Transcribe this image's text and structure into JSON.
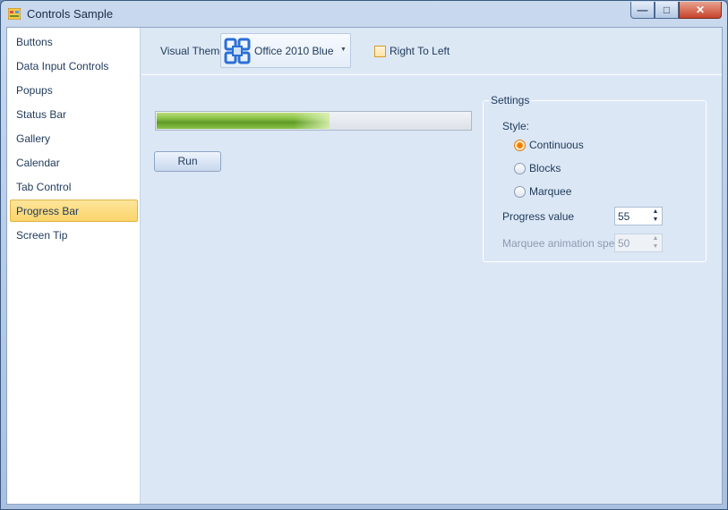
{
  "window": {
    "title": "Controls Sample"
  },
  "nav": {
    "items": [
      {
        "label": "Buttons",
        "selected": false
      },
      {
        "label": "Data Input Controls",
        "selected": false
      },
      {
        "label": "Popups",
        "selected": false
      },
      {
        "label": "Status Bar",
        "selected": false
      },
      {
        "label": "Gallery",
        "selected": false
      },
      {
        "label": "Calendar",
        "selected": false
      },
      {
        "label": "Tab Control",
        "selected": false
      },
      {
        "label": "Progress Bar",
        "selected": true
      },
      {
        "label": "Screen Tip",
        "selected": false
      }
    ]
  },
  "toolbar": {
    "theme_label": "Visual Theme",
    "theme_value": "Office 2010 Blue",
    "rtl_label": "Right To Left",
    "rtl_checked": false
  },
  "progress": {
    "value": 55,
    "max": 100
  },
  "run_label": "Run",
  "settings": {
    "legend": "Settings",
    "style_label": "Style:",
    "styles": [
      {
        "label": "Continuous",
        "checked": true
      },
      {
        "label": "Blocks",
        "checked": false
      },
      {
        "label": "Marquee",
        "checked": false
      }
    ],
    "progress_value_label": "Progress value",
    "progress_value": "55",
    "marquee_speed_label": "Marquee animation speed",
    "marquee_speed_value": "50"
  },
  "colors": {
    "selection": "#fbd46b",
    "progress_fill": "#8bc34a",
    "radio_checked": "#f57c00"
  }
}
